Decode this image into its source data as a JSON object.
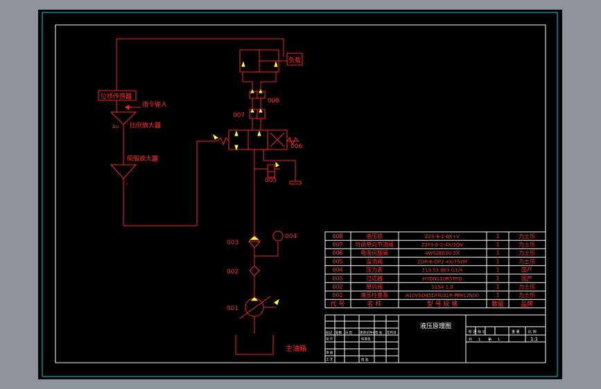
{
  "colors": {
    "background": "#000000",
    "frame": "#ffffff",
    "border": "#00d5e0",
    "line": "#ff2020",
    "accent": "#ffff00",
    "window": "#8e949c"
  },
  "labels": {
    "displacement_sensor": "位移传感器",
    "command_input": "指令输入",
    "proportional_amp": "比例放大器",
    "servo_amp": "伺服放大器",
    "load": "负载",
    "main_tank": "主油箱",
    "sum_mark": "Δu",
    "current_mark": "i"
  },
  "component_ids": [
    "008",
    "007",
    "006",
    "005",
    "004",
    "003",
    "002",
    "001"
  ],
  "bom": {
    "rows": [
      {
        "no": "008",
        "name": "液压锁",
        "model": "Z2S-6-1-6X+V",
        "qty": "1",
        "brand": "力士乐"
      },
      {
        "no": "007",
        "name": "可调单向节流阀",
        "model": "Z2FS-6-2-4X/2QV",
        "qty": "1",
        "brand": "力士乐"
      },
      {
        "no": "006",
        "name": "电液伺服阀",
        "model": "4WS2EE10-5X",
        "qty": "1",
        "brand": "力士乐"
      },
      {
        "no": "005",
        "name": "溢流阀",
        "model": "ZDR-6-DP2-4X/75YM",
        "qty": "1",
        "brand": "力士乐"
      },
      {
        "no": "004",
        "name": "压力表",
        "model": "213.53.063.G1/4",
        "qty": "1",
        "brand": "国产"
      },
      {
        "no": "003",
        "name": "过滤器",
        "model": "HYDN110R5TPD",
        "qty": "1",
        "brand": "国产"
      },
      {
        "no": "002",
        "name": "单向阀",
        "model": "S15A 1.0",
        "qty": "1",
        "brand": "力士乐"
      },
      {
        "no": "001",
        "name": "液压柱塞泵",
        "model": "A10VSO45DFR/31R-PPA12N00",
        "qty": "1",
        "brand": "力士乐"
      }
    ],
    "header": {
      "no": "代 号",
      "name": "名 称",
      "model": "型 号 规 格",
      "qty": "数量",
      "brand": "品牌"
    }
  },
  "title_block": {
    "drawing_title": "液压原理图",
    "stage_header": "阶 段 标 记",
    "weight_header": "重 量",
    "scale_header": "比 例",
    "scale": "1:1",
    "sheet_total": "共",
    "sheet_total_val": "1",
    "sheet_no": "第",
    "sheet_no_val": "1",
    "left_rows": [
      "标记",
      "设 计",
      "审 核",
      "工 艺"
    ],
    "left_cols": [
      "处数",
      "分 区",
      "更改文件号",
      "签 名",
      "年月日"
    ],
    "mid_cols": [
      "标准化",
      "批 准"
    ]
  }
}
